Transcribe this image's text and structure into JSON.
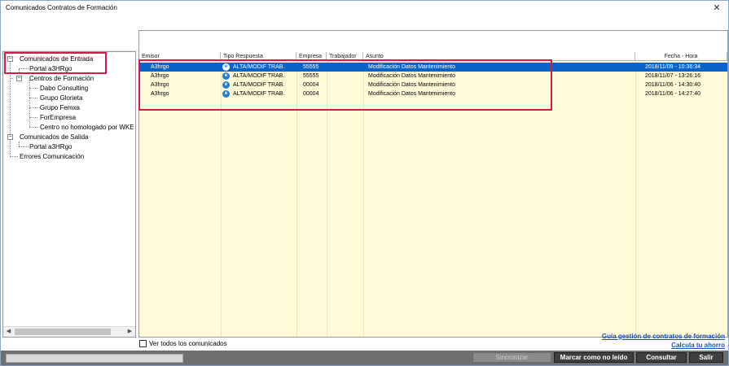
{
  "window": {
    "title": "Comunicados Contratos de Formación",
    "close_glyph": "✕"
  },
  "tree": {
    "nodes": [
      {
        "label": "Comunicados de Entrada",
        "expanded": true
      },
      {
        "label": "Portal a3HRgo"
      },
      {
        "label": "Centros de Formación",
        "expanded": true
      },
      {
        "label": "Dabo Consulting"
      },
      {
        "label": "Grupo Glorieta"
      },
      {
        "label": "Grupo Femxa"
      },
      {
        "label": "ForEmpresa"
      },
      {
        "label": "Centro no homologado por WKE"
      },
      {
        "label": "Comunicados de Salida",
        "expanded": true
      },
      {
        "label": "Portal a3HRgo"
      },
      {
        "label": "Errores Comunicación"
      }
    ],
    "toggle_minus": "−",
    "scroll_left": "◀",
    "scroll_right": "▶"
  },
  "list": {
    "columns": [
      "Emisor",
      "Tipo Respuesta",
      "Empresa",
      "Trabajador",
      "Asunto",
      "Fecha - Hora"
    ],
    "icon_glyph": "e",
    "rows": [
      {
        "emisor": "A3hrgo",
        "tipo": "ALTA/MODIF TRAB.",
        "empresa": "55555",
        "trabajador": "",
        "asunto": "Modificación Datos Mantenimiento",
        "fecha": "2018/11/09 - 10:36:34",
        "selected": true
      },
      {
        "emisor": "A3hrgo",
        "tipo": "ALTA/MODIF TRAB.",
        "empresa": "55555",
        "trabajador": "",
        "asunto": "Modificación Datos Mantenimiento",
        "fecha": "2018/11/07 - 13:26:16"
      },
      {
        "emisor": "A3hrgo",
        "tipo": "ALTA/MODIF TRAB.",
        "empresa": "00004",
        "trabajador": "",
        "asunto": "Modificación Datos Mantenimiento",
        "fecha": "2018/11/06 - 14:30:40"
      },
      {
        "emisor": "A3hrgo",
        "tipo": "ALTA/MODIF TRAB.",
        "empresa": "00004",
        "trabajador": "",
        "asunto": "Modificación Datos Mantenimiento",
        "fecha": "2018/11/06 - 14:27:40"
      }
    ]
  },
  "footer": {
    "checkbox_label": "Ver todos los comunicados",
    "link_guide": "Guía gestión de contratos de formación",
    "link_savings": "Calcula tu ahorro"
  },
  "buttons": {
    "sync": "Sincronizar",
    "mark_unread": "Marcar como no leído",
    "consult": "Consultar",
    "exit": "Salir"
  },
  "colors": {
    "selection": "#0a64c8",
    "list_background": "#fffbd8",
    "highlight_box": "#d01b4b",
    "link": "#1d4fb4"
  }
}
